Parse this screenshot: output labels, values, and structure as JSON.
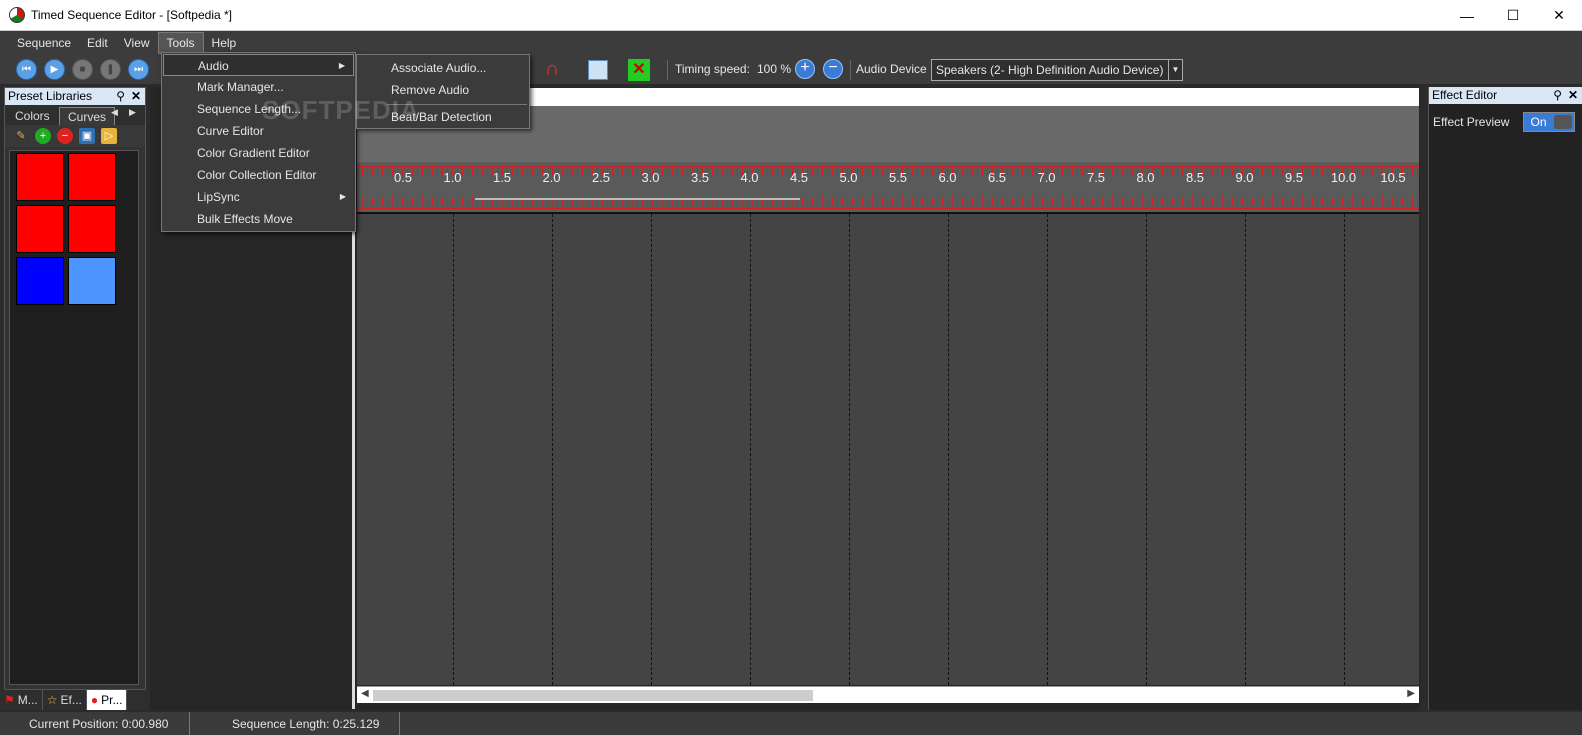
{
  "window": {
    "title": "Timed Sequence Editor - [Softpedia *]"
  },
  "menubar": {
    "items": [
      "Sequence",
      "Edit",
      "View",
      "Tools",
      "Help"
    ],
    "active": "Tools"
  },
  "tools_menu": {
    "items": [
      {
        "label": "Audio",
        "submenu": true
      },
      {
        "label": "Mark Manager...",
        "submenu": false
      },
      {
        "label": "Sequence Length...",
        "submenu": false
      },
      {
        "label": "Curve Editor",
        "submenu": false
      },
      {
        "label": "Color Gradient Editor",
        "submenu": false
      },
      {
        "label": "Color Collection Editor",
        "submenu": false
      },
      {
        "label": "LipSync",
        "submenu": true
      },
      {
        "label": "Bulk Effects Move",
        "submenu": false
      }
    ]
  },
  "audio_submenu": {
    "items": [
      "Associate Audio...",
      "Remove Audio",
      "Beat/Bar Detection"
    ]
  },
  "toolbar": {
    "timing_speed_label": "Timing speed:",
    "timing_speed_value": "100 %",
    "audio_device_label": "Audio Device",
    "audio_device_value": "Speakers (2- High Definition Audio Device)"
  },
  "preset_libraries": {
    "title": "Preset Libraries",
    "tabs": [
      "Colors",
      "Curves"
    ],
    "selected_tab": "Colors",
    "swatches": [
      "#ff0000",
      "#ff0000",
      "#ff0000",
      "#ff0000",
      "#0000ff",
      "#4d94ff"
    ]
  },
  "bottom_tabs": [
    "M...",
    "Ef...",
    "Pr..."
  ],
  "timeline": {
    "ruler_labels": [
      "0.5",
      "1.0",
      "1.5",
      "2.0",
      "2.5",
      "3.0",
      "3.5",
      "4.0",
      "4.5",
      "5.0",
      "5.5",
      "6.0",
      "6.5",
      "7.0",
      "7.5",
      "8.0",
      "8.5",
      "9.0",
      "9.5",
      "10.0",
      "10.5"
    ]
  },
  "effect_editor": {
    "title": "Effect Editor",
    "preview_label": "Effect Preview",
    "toggle_value": "On"
  },
  "status": {
    "current_position": "Current Position:  0:00.980",
    "sequence_length": "Sequence Length:  0:25.129"
  },
  "watermark": "SOFTPEDIA"
}
